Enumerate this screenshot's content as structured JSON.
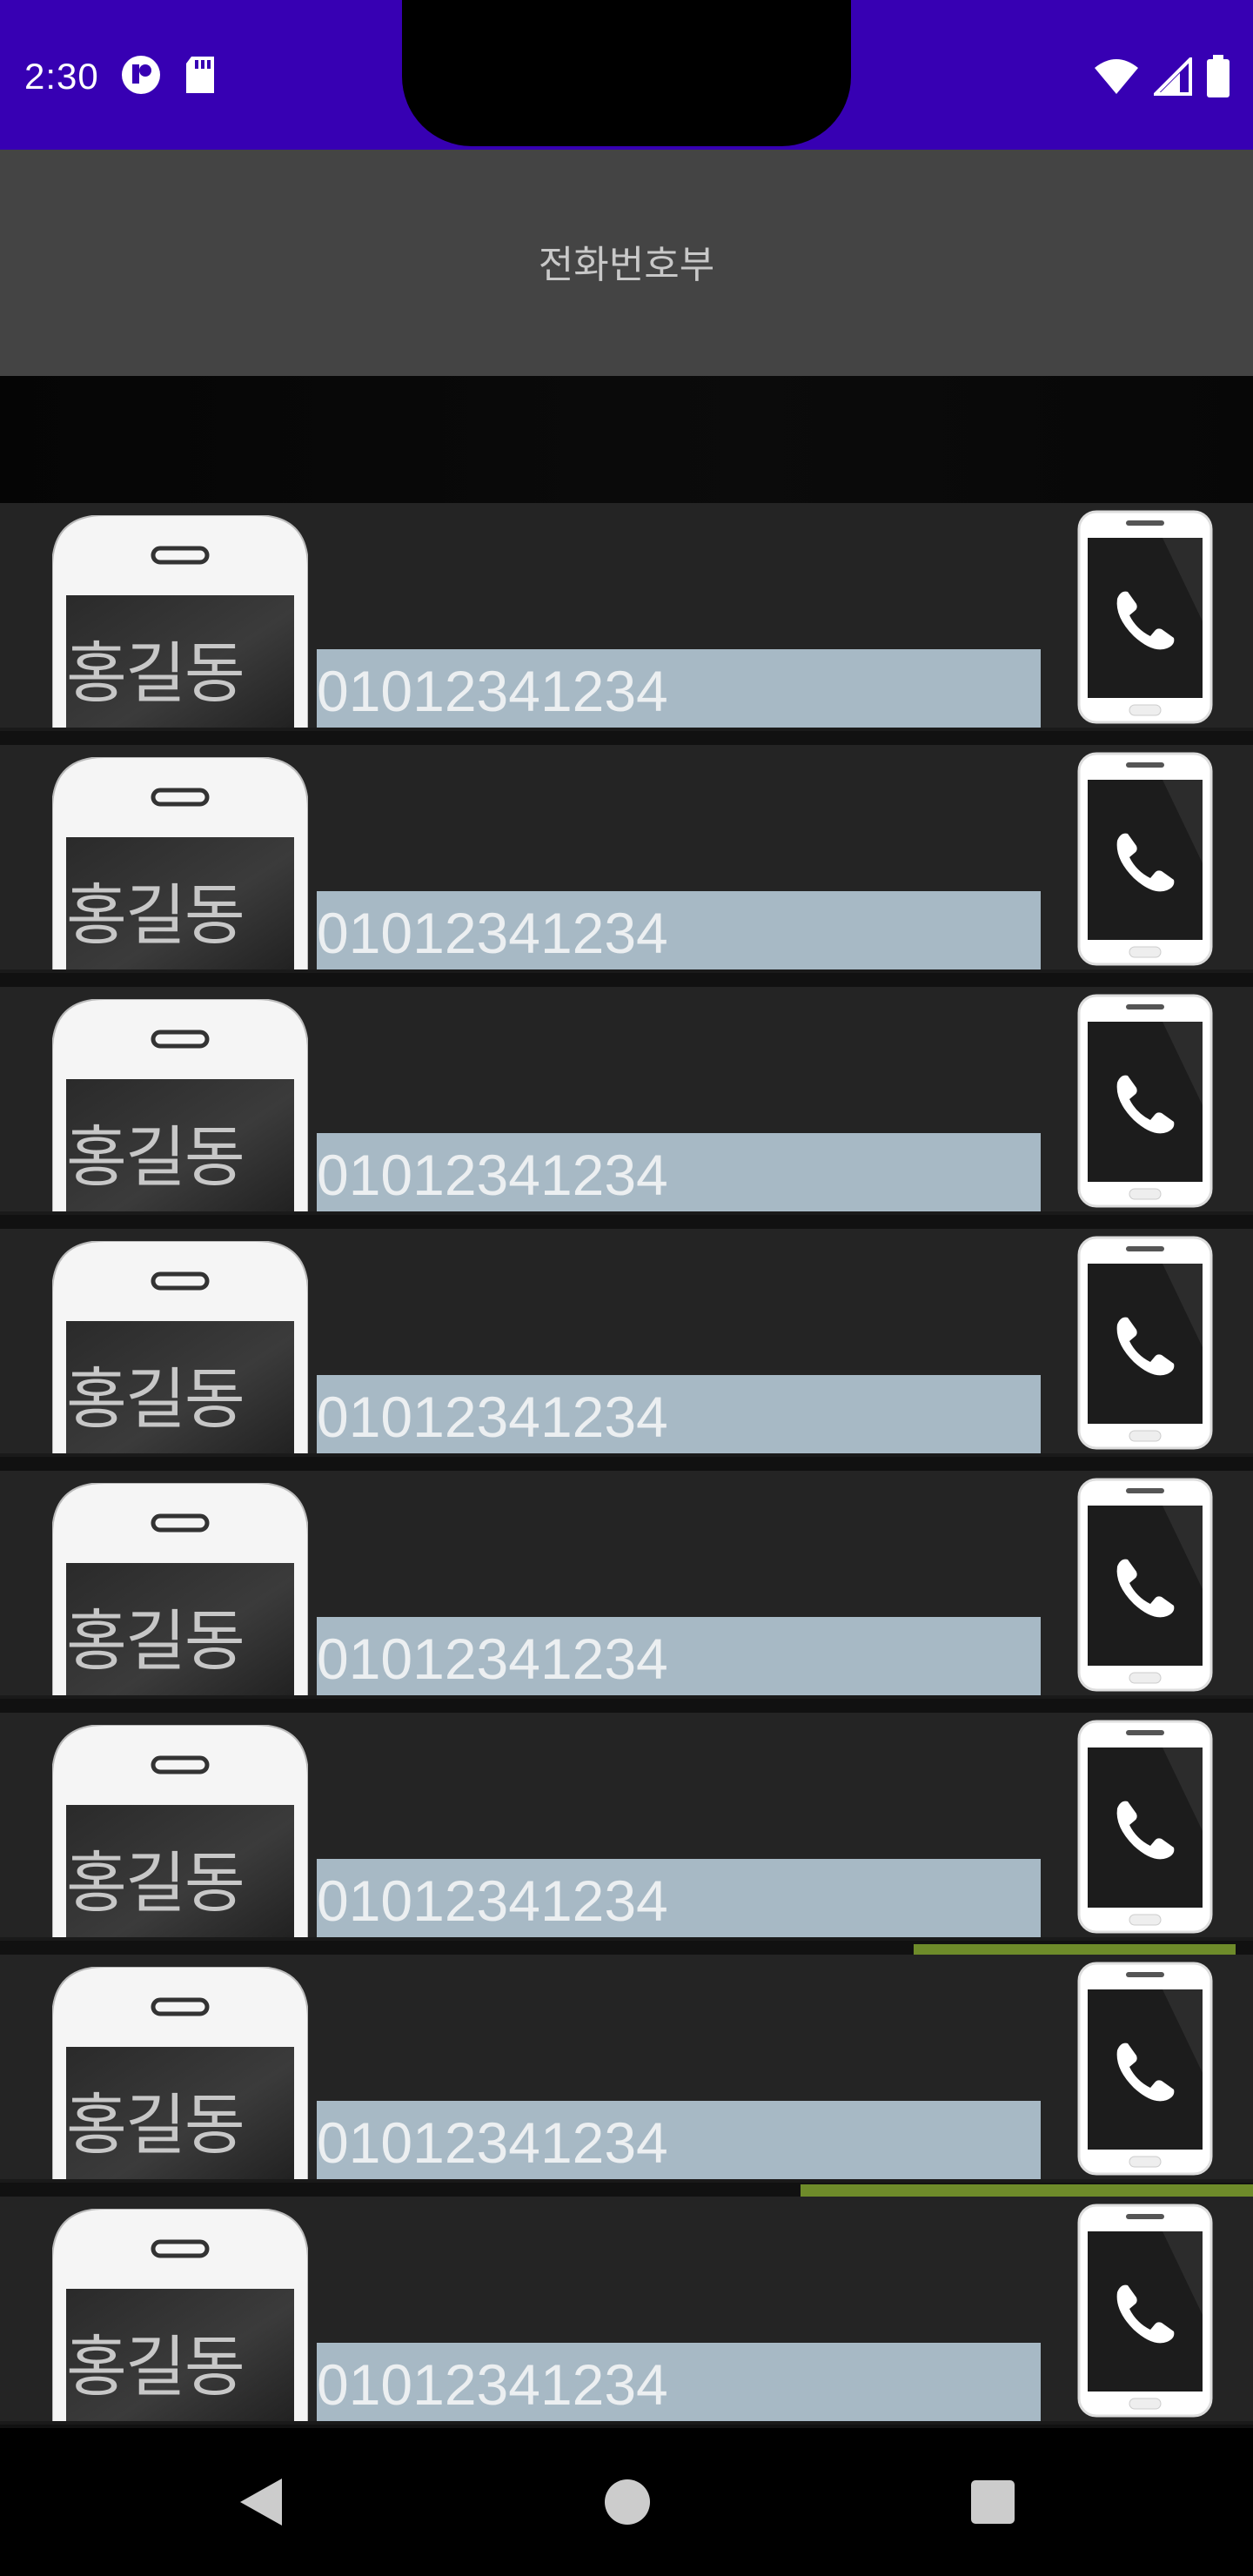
{
  "status_bar": {
    "time": "2:30",
    "left_icons": [
      "media-playback-icon",
      "sd-card-icon"
    ],
    "right_icons": [
      "wifi-icon",
      "cellular-signal-icon",
      "battery-icon"
    ],
    "background_color": "#3700b3"
  },
  "app_bar": {
    "title": "전화번호부",
    "background_color": "#444444"
  },
  "contacts": [
    {
      "name": "홍길동",
      "phone": "01012341234"
    },
    {
      "name": "홍길동",
      "phone": "01012341234"
    },
    {
      "name": "홍길동",
      "phone": "01012341234"
    },
    {
      "name": "홍길동",
      "phone": "01012341234"
    },
    {
      "name": "홍길동",
      "phone": "01012341234"
    },
    {
      "name": "홍길동",
      "phone": "01012341234"
    },
    {
      "name": "홍길동",
      "phone": "01012341234"
    },
    {
      "name": "홍길동",
      "phone": "01012341234"
    }
  ],
  "colors": {
    "row_background": "#242424",
    "phone_field": "#a7b9c5"
  },
  "nav_bar": {
    "buttons": [
      "back-icon",
      "home-icon",
      "recents-icon"
    ]
  }
}
